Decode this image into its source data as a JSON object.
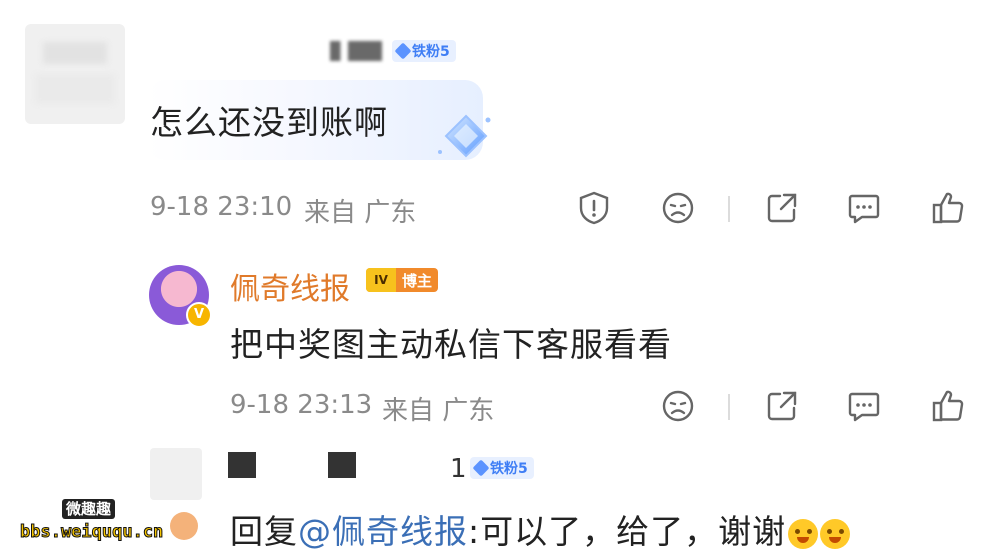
{
  "comment1": {
    "username_partial": "ı",
    "badge": "铁粉5",
    "text": "怎么还没到账啊",
    "time": "9-18 23:10",
    "source": "来自 广东"
  },
  "reply1": {
    "author": "佩奇线报",
    "badge": "博主",
    "badge_icon_text": "IV",
    "verified_mark": "V",
    "text": "把中奖图主动私信下客服看看",
    "time": "9-18 23:13",
    "source": "来自 广东"
  },
  "reply2": {
    "username_partial": "1",
    "badge": "铁粉5",
    "prefix": "回复",
    "mention": "@佩奇线报",
    "text": ":可以了，给了，谢谢"
  },
  "watermark": {
    "title": "微趣趣",
    "url": "bbs.weiququ.cn"
  },
  "colors": {
    "accent_blue": "#3f7ef5",
    "mention_blue": "#3b6fb6",
    "blogger_orange": "#e07a2a",
    "meta_gray": "#8a8a8a"
  },
  "icons": {
    "comment1": [
      "report-icon",
      "dislike-icon",
      "share-icon",
      "comment-icon",
      "like-icon"
    ],
    "reply1": [
      "dislike-icon",
      "share-icon",
      "comment-icon",
      "like-icon"
    ]
  }
}
